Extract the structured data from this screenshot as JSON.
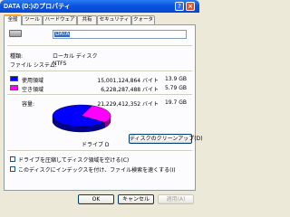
{
  "window": {
    "title": "DATA (D:)のプロパティ",
    "help_glyph": "?",
    "close_glyph": "×",
    "title_color": "#0a54e0"
  },
  "tabs": [
    {
      "label": "全般",
      "active": true
    },
    {
      "label": "ツール",
      "active": false
    },
    {
      "label": "ハードウェア",
      "active": false
    },
    {
      "label": "共有",
      "active": false
    },
    {
      "label": "セキュリティ",
      "active": false
    },
    {
      "label": "クォータ",
      "active": false
    }
  ],
  "general": {
    "volume_name": "DATA",
    "type_label": "種類:",
    "type_value": "ローカル ディスク",
    "fs_label": "ファイル システム:",
    "fs_value": "NTFS",
    "used_label": "使用領域",
    "used_bytes": "15,001,124,864 バイト",
    "used_size": "13.9 GB",
    "used_color": "#0000ff",
    "free_label": "空き領域",
    "free_bytes": "6,228,287,488 バイト",
    "free_size": "5.79 GB",
    "free_color": "#ff00ff",
    "capacity_label": "容量:",
    "capacity_bytes": "21,229,412,352 バイト",
    "capacity_size": "19.7 GB",
    "drive_label": "ドライブ D",
    "cleanup_button": "ディスクのクリーンアップ(D)",
    "compress_label": "ドライブを圧縮してディスク領域を空ける(C)",
    "compress_checked": false,
    "index_label": "このディスクにインデックスを付け、ファイル検索を速くする(I)",
    "index_checked": false
  },
  "chart_data": {
    "type": "pie",
    "categories": [
      "使用領域",
      "空き領域"
    ],
    "values": [
      15001124864,
      6228287488
    ],
    "colors": [
      "#0000ff",
      "#ff00ff"
    ],
    "title": "ドライブ D"
  },
  "footer": {
    "ok": "OK",
    "cancel": "キャンセル",
    "apply": "適用(A)"
  }
}
